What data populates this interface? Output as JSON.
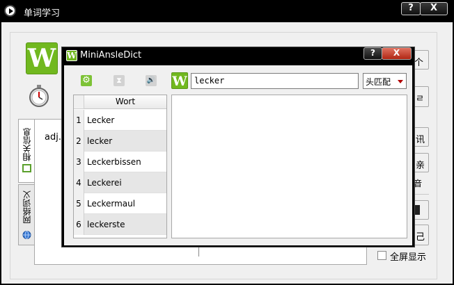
{
  "outer_window": {
    "title": "单词学习",
    "help_label": "?",
    "close_label": "X",
    "pos_text": "adj.",
    "tabs": [
      {
        "label": "相关信息"
      },
      {
        "label": "网络词义"
      }
    ],
    "right_panel": {
      "btn_top_arrow": "个",
      "btn_second": "ㄹ",
      "btn_third": "讯",
      "btn_fourth": "亲",
      "audio_label": "音",
      "btn_fifth": "",
      "btn_sixth": "己",
      "fullscreen_label": "全屏显示",
      "fullscreen_checked": false
    }
  },
  "dialog": {
    "title": "MiniAnsleDict",
    "help_label": "?",
    "close_label": "X",
    "search": {
      "value": "lecker"
    },
    "match_mode": {
      "selected": "头匹配"
    },
    "word_table": {
      "header": "Wort",
      "rows": [
        {
          "num": "1",
          "word": "Lecker"
        },
        {
          "num": "2",
          "word": "lecker"
        },
        {
          "num": "3",
          "word": "Leckerbissen"
        },
        {
          "num": "4",
          "word": "Leckerei"
        },
        {
          "num": "5",
          "word": "Leckermaul"
        },
        {
          "num": "6",
          "word": "leckerste"
        }
      ]
    },
    "logo_letter": "W"
  },
  "brand": {
    "logo_letter": "W",
    "logo_color": "#71b81f"
  },
  "icons": [
    "play-icon",
    "stopwatch-icon",
    "gear-icon",
    "hourglass-icon",
    "speaker-icon",
    "dropdown-arrow-icon",
    "globe-icon",
    "info-icon"
  ]
}
